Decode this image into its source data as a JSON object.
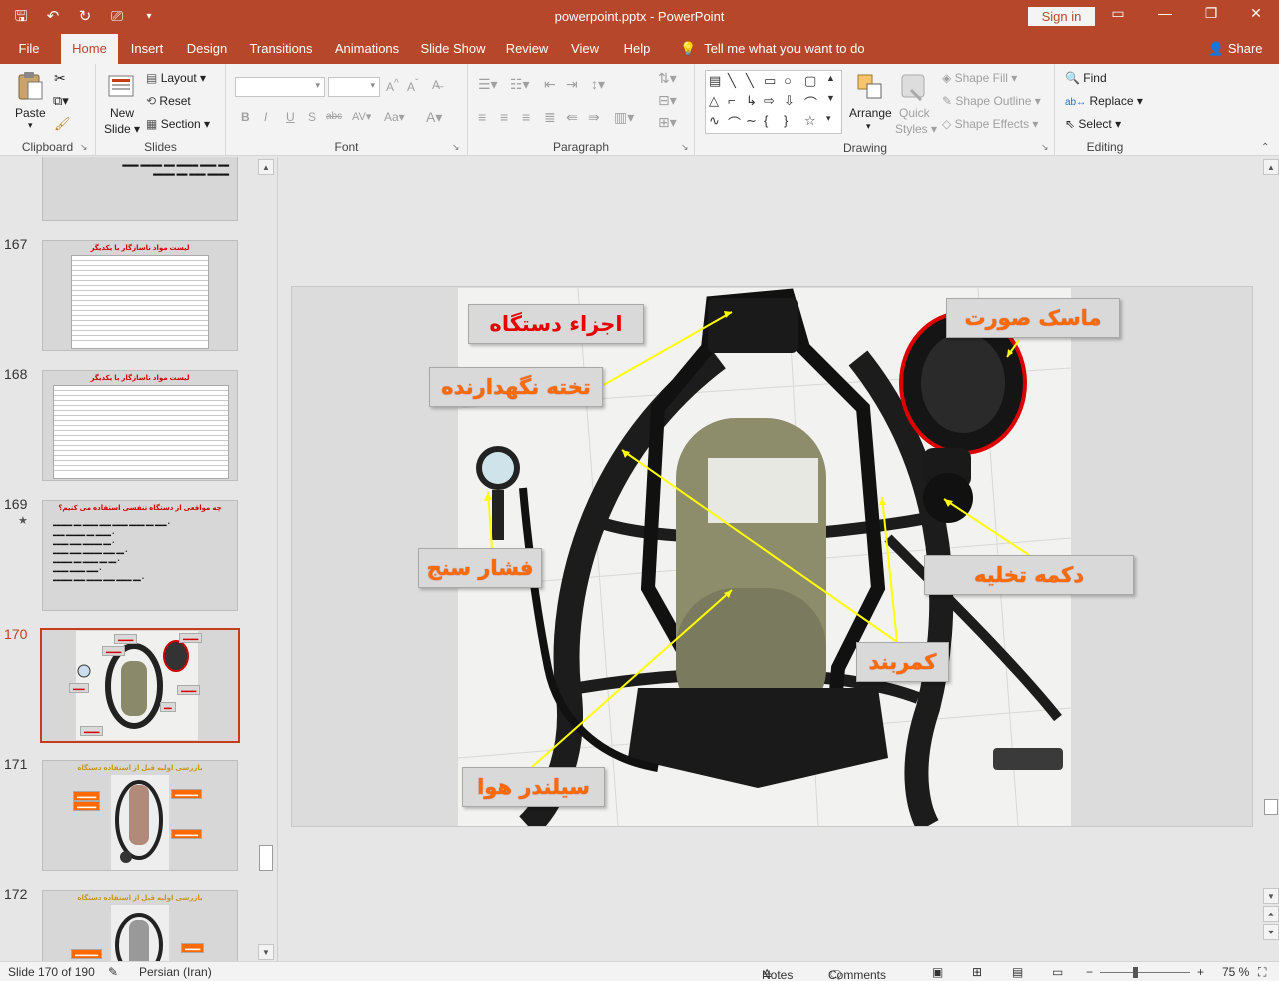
{
  "app": {
    "title": "powerpoint.pptx  -  PowerPoint",
    "signin": "Sign in"
  },
  "tabs": [
    {
      "label": "File"
    },
    {
      "label": "Home"
    },
    {
      "label": "Insert"
    },
    {
      "label": "Design"
    },
    {
      "label": "Transitions"
    },
    {
      "label": "Animations"
    },
    {
      "label": "Slide Show"
    },
    {
      "label": "Review"
    },
    {
      "label": "View"
    },
    {
      "label": "Help"
    }
  ],
  "tellme": "Tell me what you want to do",
  "share": "Share",
  "ribbon": {
    "clipboard": {
      "label": "Clipboard",
      "paste": "Paste"
    },
    "slides": {
      "label": "Slides",
      "new_slide": "New",
      "new_slide2": "Slide",
      "layout": "Layout",
      "reset": "Reset",
      "section": "Section"
    },
    "font": {
      "label": "Font"
    },
    "paragraph": {
      "label": "Paragraph"
    },
    "drawing": {
      "label": "Drawing",
      "arrange": "Arrange",
      "quick": "Quick",
      "styles": "Styles",
      "fill": "Shape Fill",
      "outline": "Shape Outline",
      "effects": "Shape Effects"
    },
    "editing": {
      "label": "Editing",
      "find": "Find",
      "replace": "Replace",
      "select": "Select"
    }
  },
  "thumbnails": [
    {
      "num": "167",
      "title": "لیست مواد ناسازگار با یکدیگر"
    },
    {
      "num": "168",
      "title": "لیست مواد ناسازگار با یکدیگر"
    },
    {
      "num": "169",
      "star": "★",
      "title": "چه مواقعی از دستگاه تنفسی استفاده می کنیم؟"
    },
    {
      "num": "170"
    },
    {
      "num": "171",
      "title": "بازرسی اولیه قبل از استفاده دستگاه"
    },
    {
      "num": "172",
      "title": "بازرسی اولیه قبل از استفاده دستگاه"
    }
  ],
  "slide": {
    "labels": {
      "device_parts": "اجزاء دستگاه",
      "harness": "تخته نگهدارنده",
      "face_mask": "ماسک صورت",
      "gauge": "فشار سنج",
      "purge": "دکمه تخلیه",
      "belt": "کمربند",
      "cylinder": "سیلندر هوا"
    }
  },
  "statusbar": {
    "slide_of": "Slide 170 of 190",
    "language": "Persian (Iran)",
    "notes": "Notes",
    "comments": "Comments",
    "zoom": "75 %"
  }
}
